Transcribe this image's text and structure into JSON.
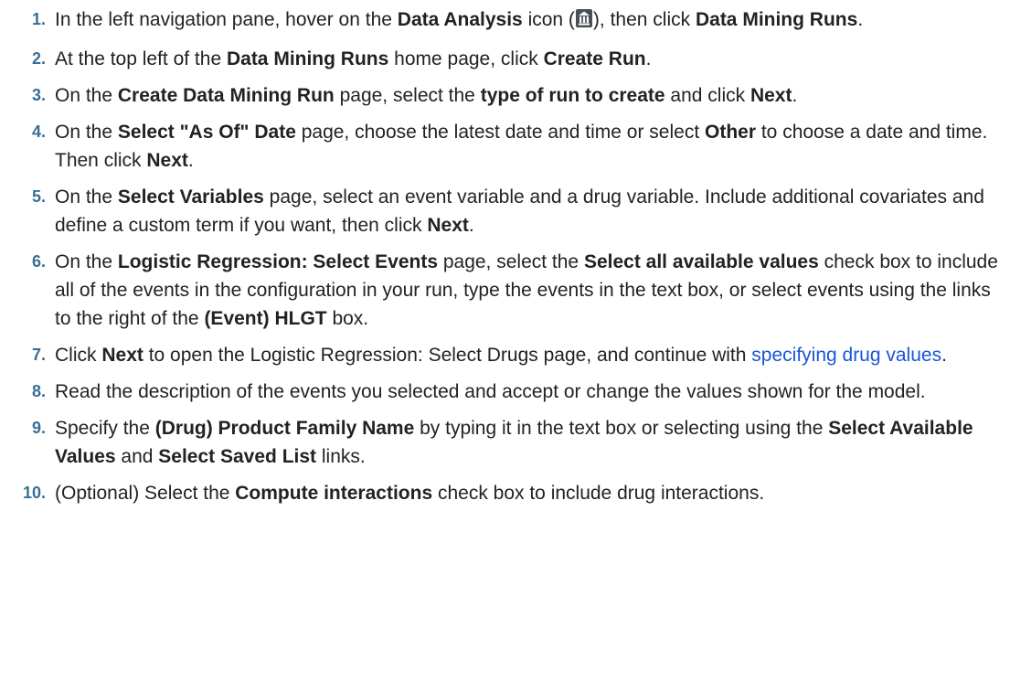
{
  "steps": [
    {
      "number": "1.",
      "parts": [
        {
          "t": "In the left navigation pane, hover on the "
        },
        {
          "t": "Data Analysis",
          "b": true
        },
        {
          "t": " icon ("
        },
        {
          "icon": "data-analysis-icon"
        },
        {
          "t": "), then click "
        },
        {
          "t": "Data Mining Runs",
          "b": true
        },
        {
          "t": "."
        }
      ]
    },
    {
      "number": "2.",
      "parts": [
        {
          "t": "At the top left of the "
        },
        {
          "t": "Data Mining Runs",
          "b": true
        },
        {
          "t": " home page, click "
        },
        {
          "t": "Create Run",
          "b": true
        },
        {
          "t": "."
        }
      ]
    },
    {
      "number": "3.",
      "parts": [
        {
          "t": "On the "
        },
        {
          "t": "Create Data Mining Run",
          "b": true
        },
        {
          "t": " page, select the "
        },
        {
          "t": "type of run to create",
          "b": true
        },
        {
          "t": " and click "
        },
        {
          "t": "Next",
          "b": true
        },
        {
          "t": "."
        }
      ]
    },
    {
      "number": "4.",
      "parts": [
        {
          "t": "On the "
        },
        {
          "t": "Select \"As Of\" Date",
          "b": true
        },
        {
          "t": " page, choose the latest date and time or select "
        },
        {
          "t": "Other",
          "b": true
        },
        {
          "t": " to choose a date and time. Then click "
        },
        {
          "t": "Next",
          "b": true
        },
        {
          "t": "."
        }
      ]
    },
    {
      "number": "5.",
      "parts": [
        {
          "t": "On the "
        },
        {
          "t": "Select Variables",
          "b": true
        },
        {
          "t": " page, select an event variable and a drug variable. Include additional covariates and define a custom term if you want, then click "
        },
        {
          "t": "Next",
          "b": true
        },
        {
          "t": "."
        }
      ]
    },
    {
      "number": "6.",
      "parts": [
        {
          "t": "On the "
        },
        {
          "t": "Logistic Regression: Select Events",
          "b": true
        },
        {
          "t": " page, select the "
        },
        {
          "t": "Select all available values",
          "b": true
        },
        {
          "t": " check box to include all of the events in the configuration in your run, type the events in the text box, or select events using the links to the right of the "
        },
        {
          "t": "(Event) HLGT",
          "b": true
        },
        {
          "t": " box."
        }
      ]
    },
    {
      "number": "7.",
      "parts": [
        {
          "t": "Click "
        },
        {
          "t": "Next",
          "b": true
        },
        {
          "t": " to open the Logistic Regression: Select Drugs page, and continue with "
        },
        {
          "t": "specifying drug values",
          "link": true
        },
        {
          "t": "."
        }
      ]
    },
    {
      "number": "8.",
      "parts": [
        {
          "t": "Read the description of the events you selected and accept or change the values shown for the model."
        }
      ]
    },
    {
      "number": "9.",
      "parts": [
        {
          "t": "Specify the "
        },
        {
          "t": "(Drug) Product Family Name",
          "b": true
        },
        {
          "t": " by typing it in the text box or selecting using the "
        },
        {
          "t": "Select Available Values",
          "b": true
        },
        {
          "t": " and "
        },
        {
          "t": "Select Saved List",
          "b": true
        },
        {
          "t": " links."
        }
      ]
    },
    {
      "number": "10.",
      "parts": [
        {
          "t": "(Optional) Select the "
        },
        {
          "t": "Compute interactions",
          "b": true
        },
        {
          "t": " check box to include drug interactions."
        }
      ]
    }
  ]
}
